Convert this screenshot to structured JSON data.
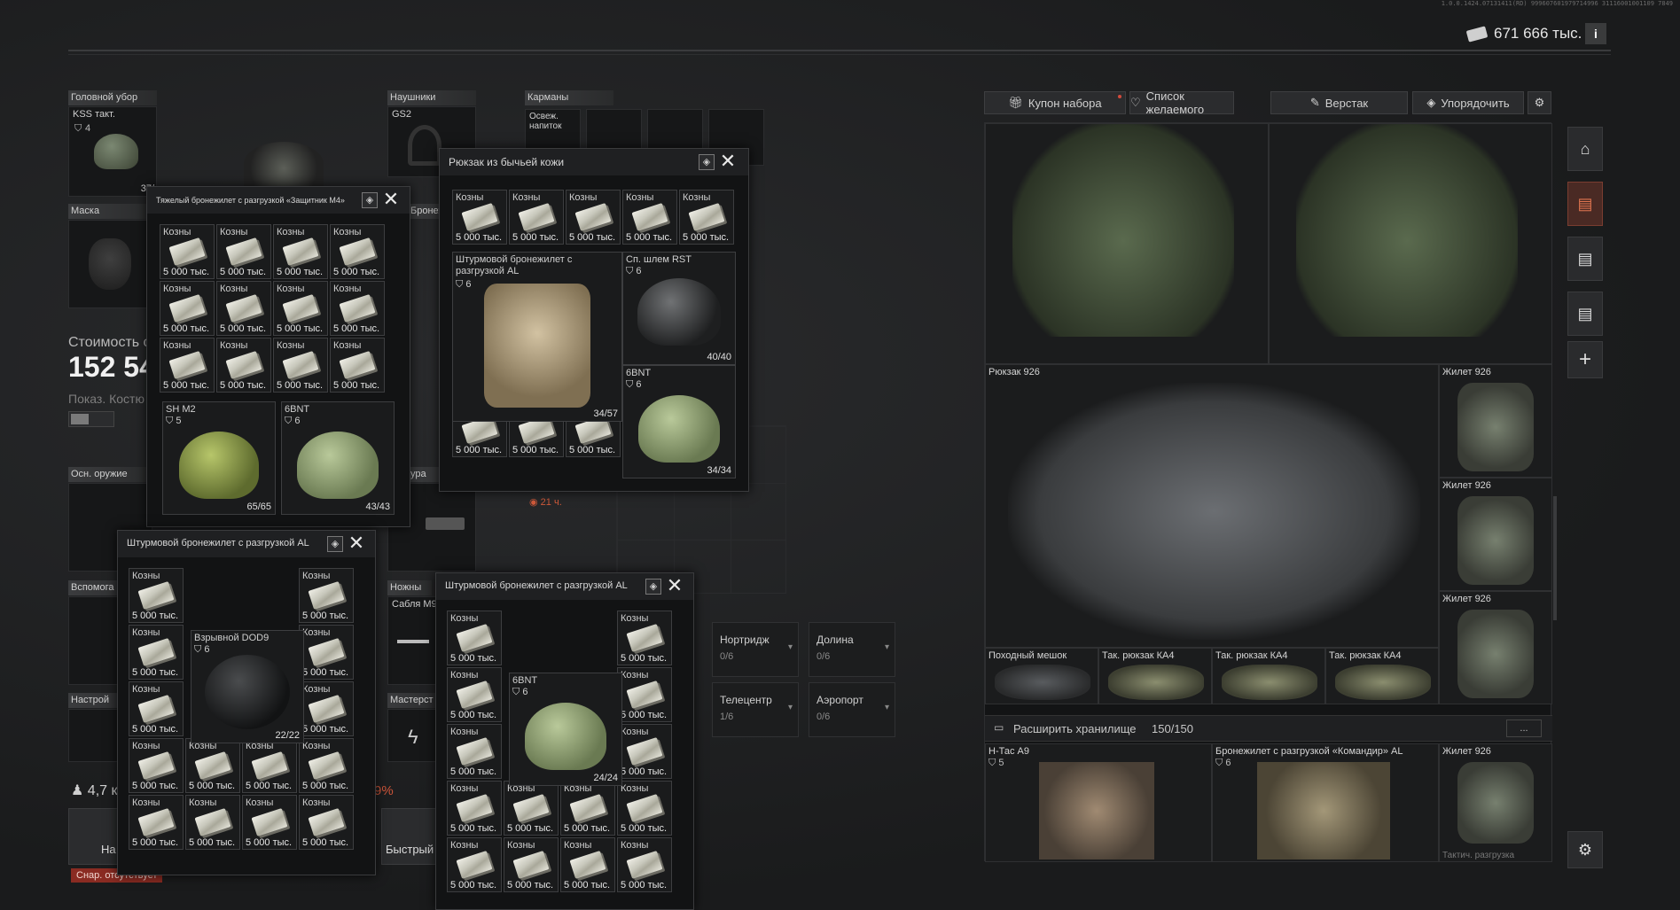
{
  "version": "1.0.0.1424.07131411(RD) 999607601979714996 31116001001109 7849",
  "money": {
    "amount": "671 666 тыс.",
    "info": "i"
  },
  "equipment": {
    "headwear": {
      "label": "Головной убор",
      "item": "KSS такт.",
      "armor": "4",
      "durability": "37/"
    },
    "earpiece": {
      "label": "Наушники",
      "item": "GS2"
    },
    "pockets": {
      "label": "Карманы",
      "item": "Освеж. напиток"
    },
    "mask": {
      "label": "Маска"
    },
    "vest_label": "Бронежил",
    "value_label": "Стоимость с",
    "value": "152 54",
    "show_label": "Показ. Костю",
    "primary": "Осн. оружие",
    "secondary": "Вспомога",
    "holster": "ура",
    "knives": "Ножны",
    "knife_item": "Сабля М9",
    "settings": "Настрой",
    "master": "Мастерст",
    "timer": "21 ч.",
    "weight": "4,7 к",
    "percent": "9%",
    "quick": "Быстрый",
    "loadout_btn": "На",
    "missing_ammo": "Снар. отсутствует"
  },
  "stash_tabs": [
    {
      "label": "Купон набора",
      "icon": "gift-icon"
    },
    {
      "label": "Список желаемого",
      "icon": "heart-icon"
    },
    {
      "label": "Верстак",
      "icon": "wrench-icon"
    },
    {
      "label": "Упорядочить",
      "icon": "layers-icon"
    }
  ],
  "expand": {
    "label": "Расширить хранилище",
    "count": "150/150",
    "more": "..."
  },
  "stash_items": {
    "backpack926": "Рюкзак 926",
    "vest926": "Жилет 926",
    "pohod": "Походный мешок",
    "tak1": "Так. рюкзак КА4",
    "tak2": "Так. рюкзак КА4",
    "tak3": "Так. рюкзак КА4",
    "htac": "Н-Тас А9",
    "htac_armor": "5",
    "commander": "Бронежилет с разгрузкой «Командир» AL",
    "commander_armor": "6",
    "vest926b": "Жилет 926",
    "tactic": "Тактич. разгрузка"
  },
  "tasks": [
    {
      "title": "Нортридж",
      "value": "0/6"
    },
    {
      "title": "Долина",
      "value": "0/6"
    },
    {
      "title": "Телецентр",
      "value": "1/6"
    },
    {
      "title": "Аэропорт",
      "value": "0/6"
    }
  ],
  "cash": {
    "name": "Козны",
    "amount": "5 000 тыс."
  },
  "windows": {
    "w_m4": {
      "title": "Тяжелый бронежилет с разгрузкой «Защитник M4»",
      "sh": {
        "name": "SH M2",
        "armor": "5",
        "dur": "65/65"
      },
      "bnt": {
        "name": "6BNT",
        "armor": "6",
        "dur": "43/43"
      }
    },
    "w_bull": {
      "title": "Рюкзак из бычьей кожи",
      "vest": {
        "name": "Штурмовой бронежилет с разгрузкой AL",
        "armor": "6",
        "dur": "34/57"
      },
      "rst": {
        "name": "Сп. шлем RST",
        "armor": "6",
        "dur": "40/40"
      },
      "bnt": {
        "name": "6BNT",
        "armor": "6",
        "dur": "34/34"
      }
    },
    "w_al1": {
      "title": "Штурмовой бронежилет с разгрузкой AL",
      "helm": {
        "name": "Взрывной DOD9",
        "armor": "6",
        "dur": "22/22"
      }
    },
    "w_al2": {
      "title": "Штурмовой бронежилет с разгрузкой AL",
      "bnt": {
        "name": "6BNT",
        "armor": "6",
        "dur": "24/24"
      }
    }
  }
}
